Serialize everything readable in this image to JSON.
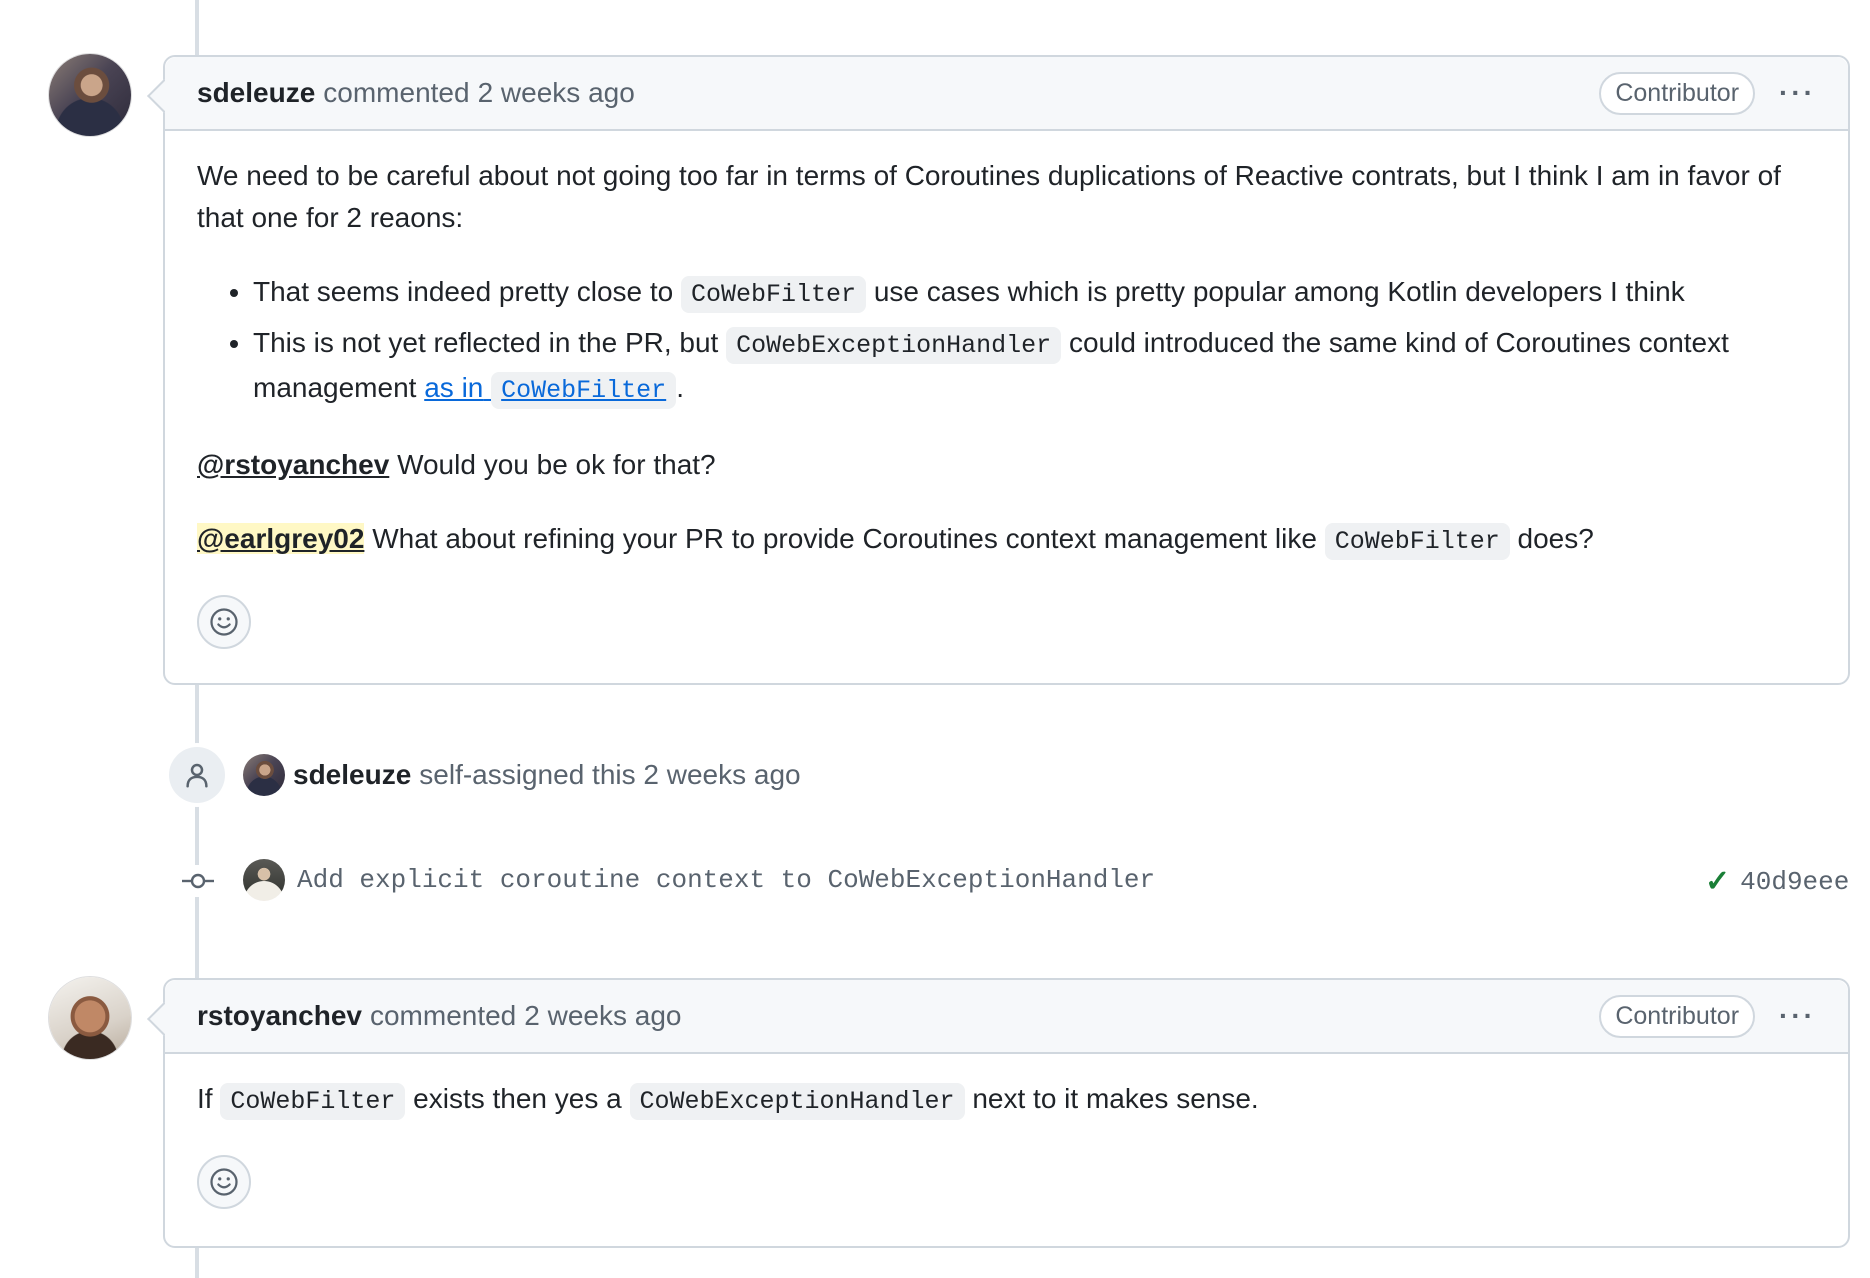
{
  "comment1": {
    "author": "sdeleuze",
    "action": "commented",
    "time": "2 weeks ago",
    "badge": "Contributor",
    "menu": "···",
    "para1": "We need to be careful about not going too far in terms of Coroutines duplications of Reactive contrats, but I think I am in favor of that one for 2 reaons:",
    "bullet1_a": "That seems indeed pretty close to",
    "bullet1_code": "CoWebFilter",
    "bullet1_b": "use cases which is pretty popular among Kotlin developers I think",
    "bullet2_a": "This is not yet reflected in the PR, but",
    "bullet2_code": "CoWebExceptionHandler",
    "bullet2_b": "could introduced the same kind of Coroutines context management",
    "bullet2_link_text": "as in",
    "bullet2_link_code": "CoWebFilter",
    "bullet2_end": ".",
    "mention1": "@rstoyanchev",
    "mention1_text": "Would you be ok for that?",
    "mention2": "@earlgrey02",
    "mention2_text_a": "What about refining your PR to provide Coroutines context management like",
    "mention2_code": "CoWebFilter",
    "mention2_text_b": "does?"
  },
  "assign_event": {
    "author": "sdeleuze",
    "text": "self-assigned this 2 weeks ago"
  },
  "commit_event": {
    "message": "Add explicit coroutine context to CoWebExceptionHandler",
    "status": "✓",
    "sha": "40d9eee"
  },
  "comment2": {
    "author": "rstoyanchev",
    "action": "commented",
    "time": "2 weeks ago",
    "badge": "Contributor",
    "menu": "···",
    "text_a": "If",
    "code_a": "CoWebFilter",
    "text_b": "exists then yes a",
    "code_b": "CoWebExceptionHandler",
    "text_c": "next to it makes sense."
  },
  "icons": [
    "smiley-icon",
    "person-icon",
    "git-commit-icon",
    "check-icon",
    "kebab-icon"
  ],
  "colors": {
    "link": "#0969da",
    "success": "#1a7f37",
    "mention_highlight": "#fff8c5",
    "border": "#d0d7de"
  }
}
